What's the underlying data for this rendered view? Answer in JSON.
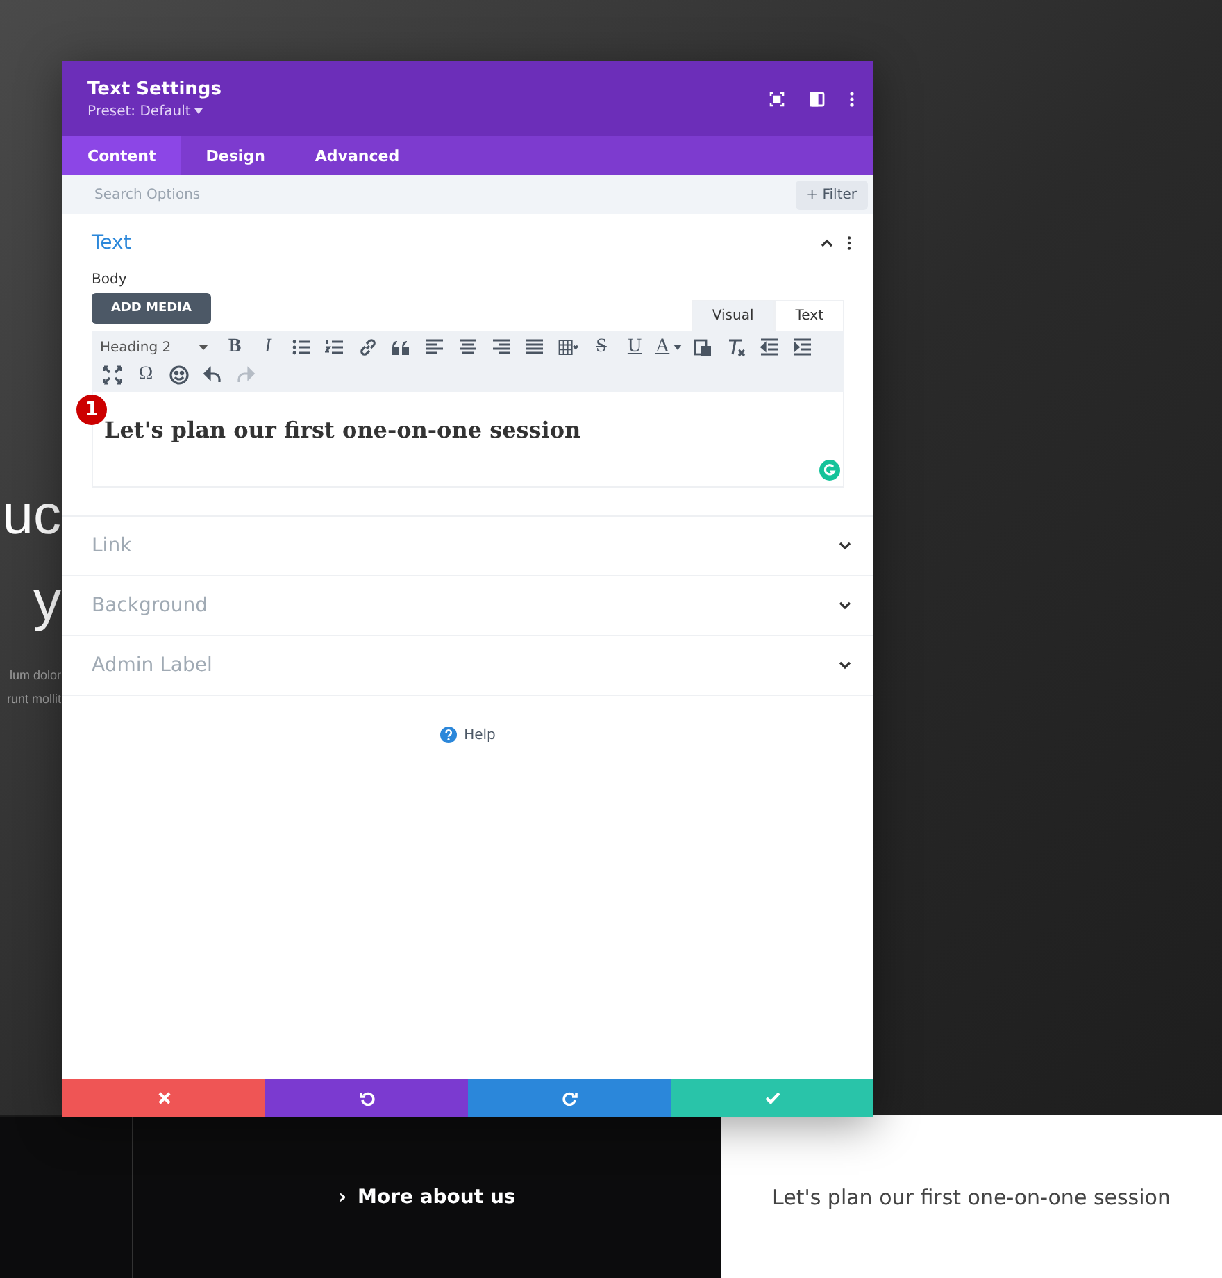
{
  "page": {
    "hero_heading_lines": [
      "uc",
      "y"
    ],
    "hero_body_lines": [
      "lum dolor",
      "runt mollit"
    ],
    "more_link": {
      "arrow": "›",
      "label": "More about us"
    },
    "card_text": "Let's plan our first one-on-one session"
  },
  "modal": {
    "title": "Text Settings",
    "preset": "Preset: Default",
    "tabs": [
      {
        "label": "Content",
        "selected": true
      },
      {
        "label": "Design",
        "selected": false
      },
      {
        "label": "Advanced",
        "selected": false
      }
    ],
    "search": {
      "placeholder": "Search Options"
    },
    "filter_button": {
      "icon": "+",
      "label": "Filter"
    },
    "sections": [
      {
        "title": "Text",
        "expanded": true
      },
      {
        "title": "Link",
        "expanded": false
      },
      {
        "title": "Background",
        "expanded": false
      },
      {
        "title": "Admin Label",
        "expanded": false
      }
    ],
    "body_label": "Body",
    "add_media": "ADD MEDIA",
    "editor_tabs": [
      {
        "label": "Visual",
        "selected": true
      },
      {
        "label": "Text",
        "selected": false
      }
    ],
    "toolbar_rows": [
      [
        {
          "kind": "select",
          "label": "Heading 2",
          "disabled": false
        },
        {
          "kind": "glyph",
          "label": "B",
          "disabled": false
        },
        {
          "kind": "glyph",
          "label": "I",
          "disabled": false
        },
        {
          "kind": "icon",
          "disabled": false
        },
        {
          "kind": "icon",
          "disabled": false
        },
        {
          "kind": "icon",
          "disabled": false
        },
        {
          "kind": "icon",
          "disabled": false
        },
        {
          "kind": "icon",
          "disabled": false
        },
        {
          "kind": "icon",
          "disabled": false
        },
        {
          "kind": "icon",
          "disabled": false
        },
        {
          "kind": "icon",
          "disabled": false
        },
        {
          "kind": "icon",
          "disabled": false
        },
        {
          "kind": "glyph",
          "label": "S",
          "disabled": false
        },
        {
          "kind": "glyph",
          "label": "U",
          "disabled": false
        },
        {
          "kind": "glyph",
          "label": "A",
          "disabled": false
        },
        {
          "kind": "icon",
          "disabled": false
        },
        {
          "kind": "icon",
          "disabled": false
        },
        {
          "kind": "icon",
          "disabled": false
        },
        {
          "kind": "icon",
          "disabled": false
        }
      ],
      [
        {
          "kind": "icon",
          "disabled": false
        },
        {
          "kind": "glyph",
          "label": "Ω",
          "disabled": false
        },
        {
          "kind": "icon",
          "disabled": false
        },
        {
          "kind": "icon",
          "disabled": false
        },
        {
          "kind": "icon",
          "disabled": true
        }
      ]
    ],
    "step_badge": "1",
    "editor_heading": "Let's plan our first one-on-one session",
    "help": "Help"
  }
}
